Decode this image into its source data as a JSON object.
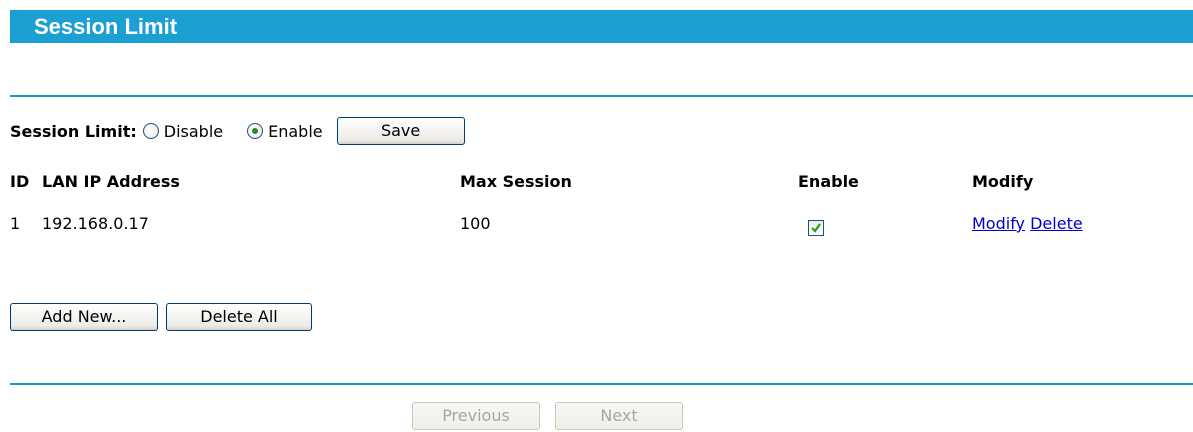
{
  "header": {
    "title": "Session Limit"
  },
  "session_limit": {
    "label": "Session Limit:",
    "options": [
      {
        "label": "Disable",
        "checked": false
      },
      {
        "label": "Enable",
        "checked": true
      }
    ],
    "save_label": "Save"
  },
  "table": {
    "headers": {
      "id": "ID",
      "lan_ip": "LAN IP Address",
      "max_session": "Max Session",
      "enable": "Enable",
      "modify": "Modify"
    },
    "rows": [
      {
        "id": "1",
        "lan_ip": "192.168.0.17",
        "max_session": "100",
        "enabled": true,
        "modify_link": "Modify",
        "delete_link": "Delete"
      }
    ]
  },
  "actions": {
    "add_new": "Add New...",
    "delete_all": "Delete All"
  },
  "pagination": {
    "previous": "Previous",
    "next": "Next",
    "previous_enabled": false,
    "next_enabled": false
  },
  "colors": {
    "title_bar": "#1c9fd2",
    "divider": "#1c94c4",
    "link": "#0000cc"
  }
}
